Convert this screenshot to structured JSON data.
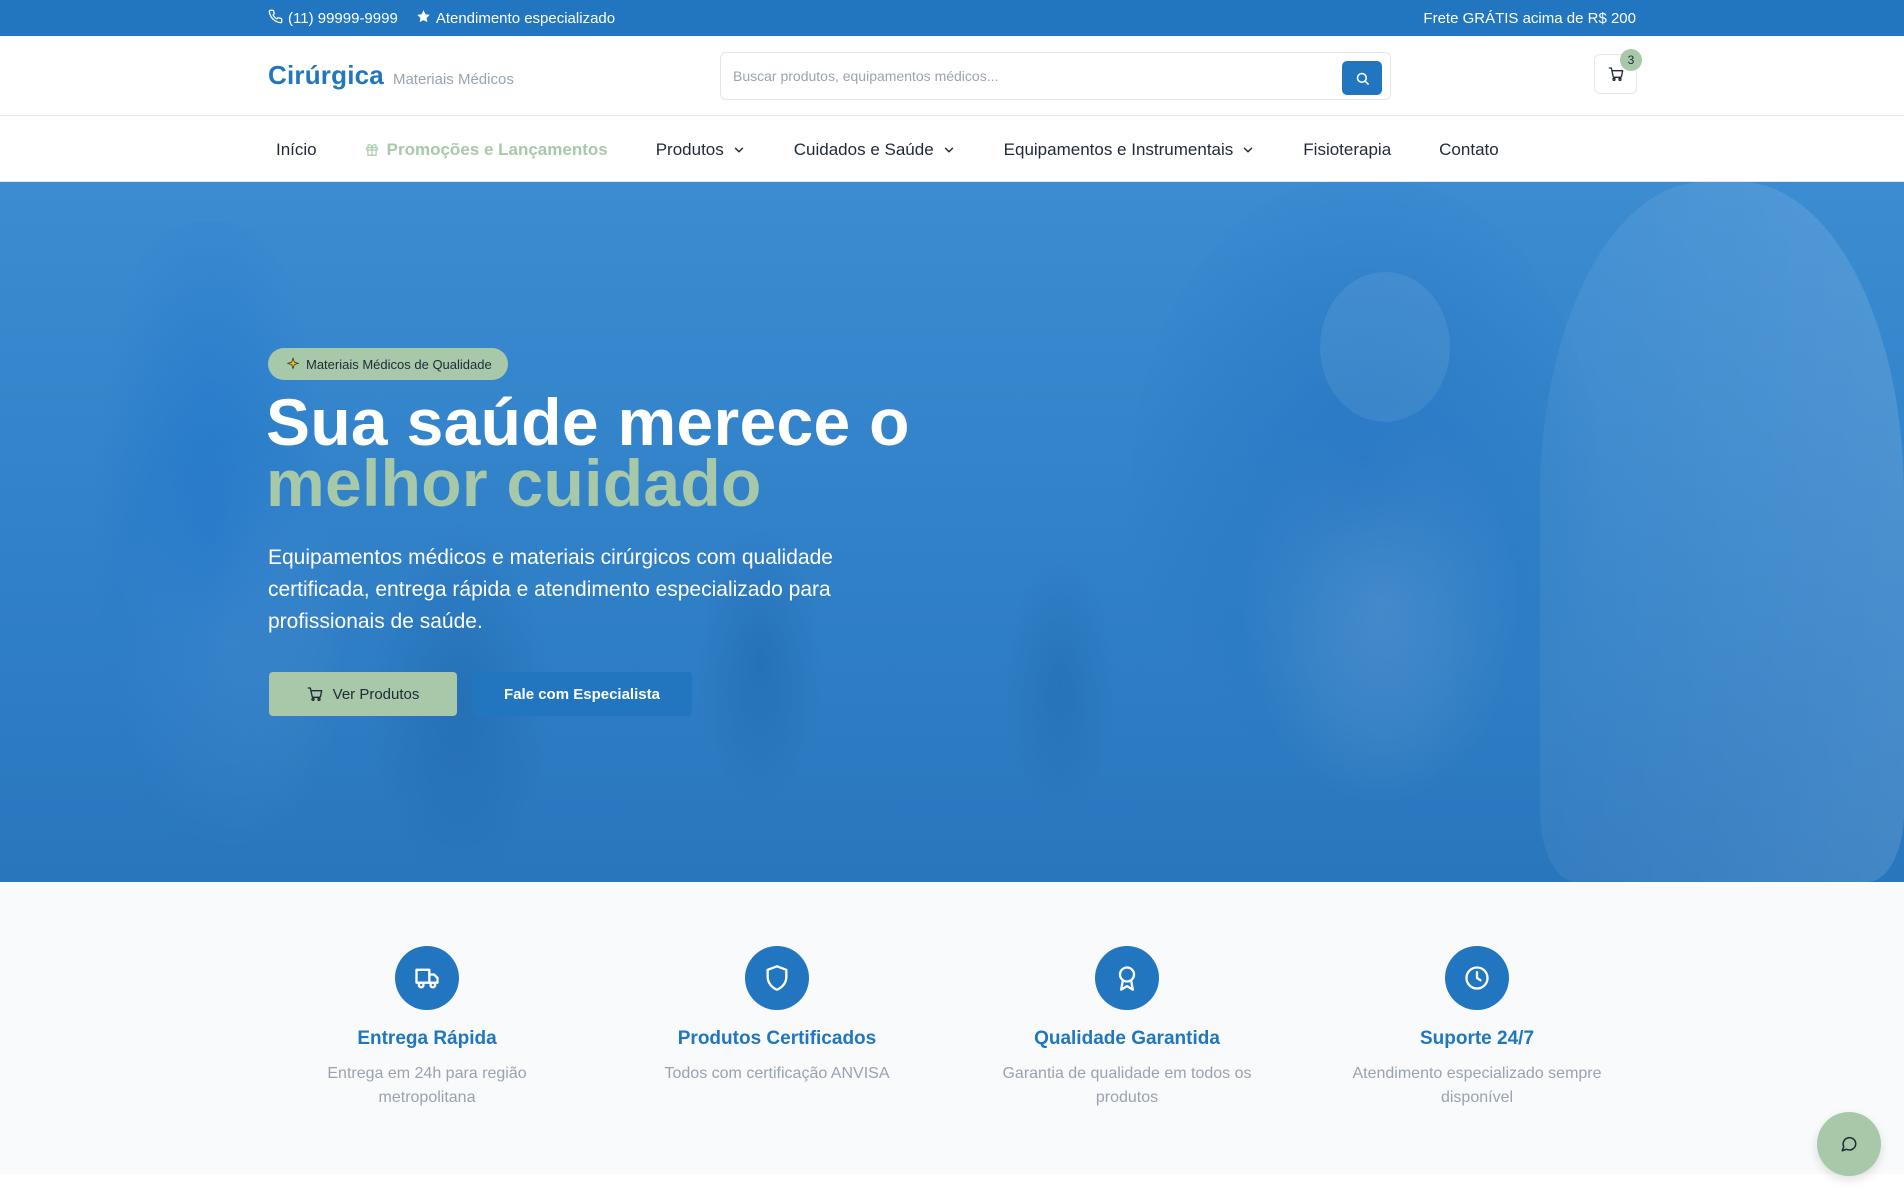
{
  "topbar": {
    "phone": "(11) 99999-9999",
    "service": "Atendimento especializado",
    "shipping": "Frete GRÁTIS acima de R$ 200"
  },
  "header": {
    "logo": "Cirúrgica",
    "logo_sub": "Materiais Médicos",
    "search_placeholder": "Buscar produtos, equipamentos médicos...",
    "cart_count": "3"
  },
  "nav": {
    "items": [
      {
        "label": "Início"
      },
      {
        "label": "Promoções e Lançamentos"
      },
      {
        "label": "Produtos"
      },
      {
        "label": "Cuidados e Saúde"
      },
      {
        "label": "Equipamentos e Instrumentais"
      },
      {
        "label": "Fisioterapia"
      },
      {
        "label": "Contato"
      }
    ]
  },
  "hero": {
    "badge": "Materiais Médicos de Qualidade",
    "title_line1": "Sua saúde merece o",
    "title_line2": "melhor cuidado",
    "description": "Equipamentos médicos e materiais cirúrgicos com qualidade certificada, entrega rápida e atendimento especializado para profissionais de saúde.",
    "primary_button": "Ver Produtos",
    "secondary_button": "Fale com Especialista"
  },
  "features": [
    {
      "icon": "truck-icon",
      "title": "Entrega Rápida",
      "description": "Entrega em 24h para região metropolitana"
    },
    {
      "icon": "shield-icon",
      "title": "Produtos Certificados",
      "description": "Todos com certificação ANVISA"
    },
    {
      "icon": "award-icon",
      "title": "Qualidade Garantida",
      "description": "Garantia de qualidade em todos os produtos"
    },
    {
      "icon": "clock-icon",
      "title": "Suporte 24/7",
      "description": "Atendimento especializado sempre disponível"
    }
  ],
  "colors": {
    "primary": "#2176bf",
    "accent": "#a8c9a9",
    "muted_text": "#9aa3ad"
  }
}
